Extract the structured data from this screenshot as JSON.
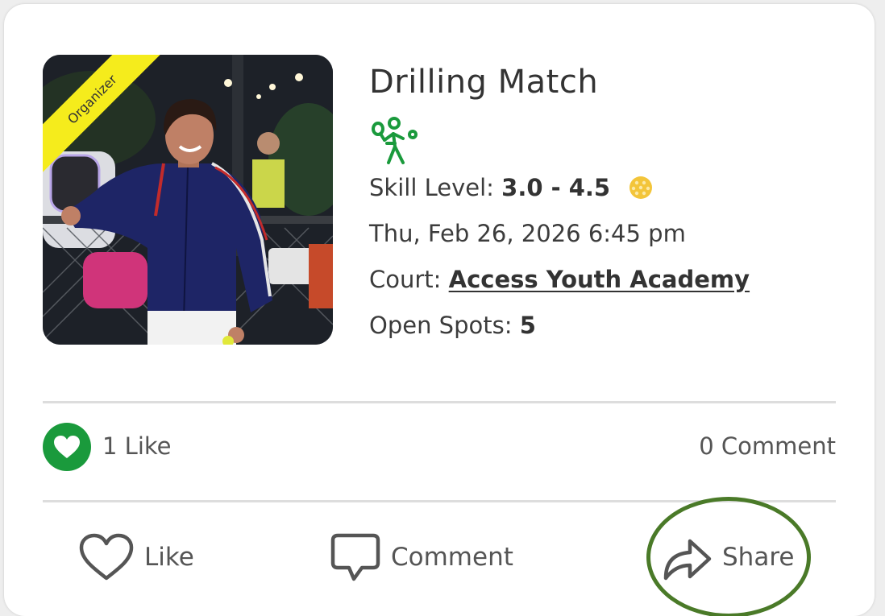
{
  "event": {
    "title": "Drilling Match",
    "organizer_badge": "Organizer",
    "sport_icon": "pickleball-player-icon",
    "skill_label": "Skill Level: ",
    "skill_value": "3.0 - 4.5",
    "skill_icon": "pickleball-icon",
    "datetime": "Thu, Feb 26, 2026 6:45 pm",
    "court_label": "Court: ",
    "court_value": "Access Youth Academy",
    "spots_label": "Open Spots: ",
    "spots_value": "5"
  },
  "stats": {
    "likes": "1 Like",
    "comments": "0 Comment"
  },
  "actions": {
    "like": "Like",
    "comment": "Comment",
    "share": "Share"
  },
  "colors": {
    "accent_green": "#1a9a3c",
    "highlight_circle": "#4a7a28",
    "badge_yellow": "#f5ec1c",
    "ball_yellow": "#f3c53a"
  }
}
